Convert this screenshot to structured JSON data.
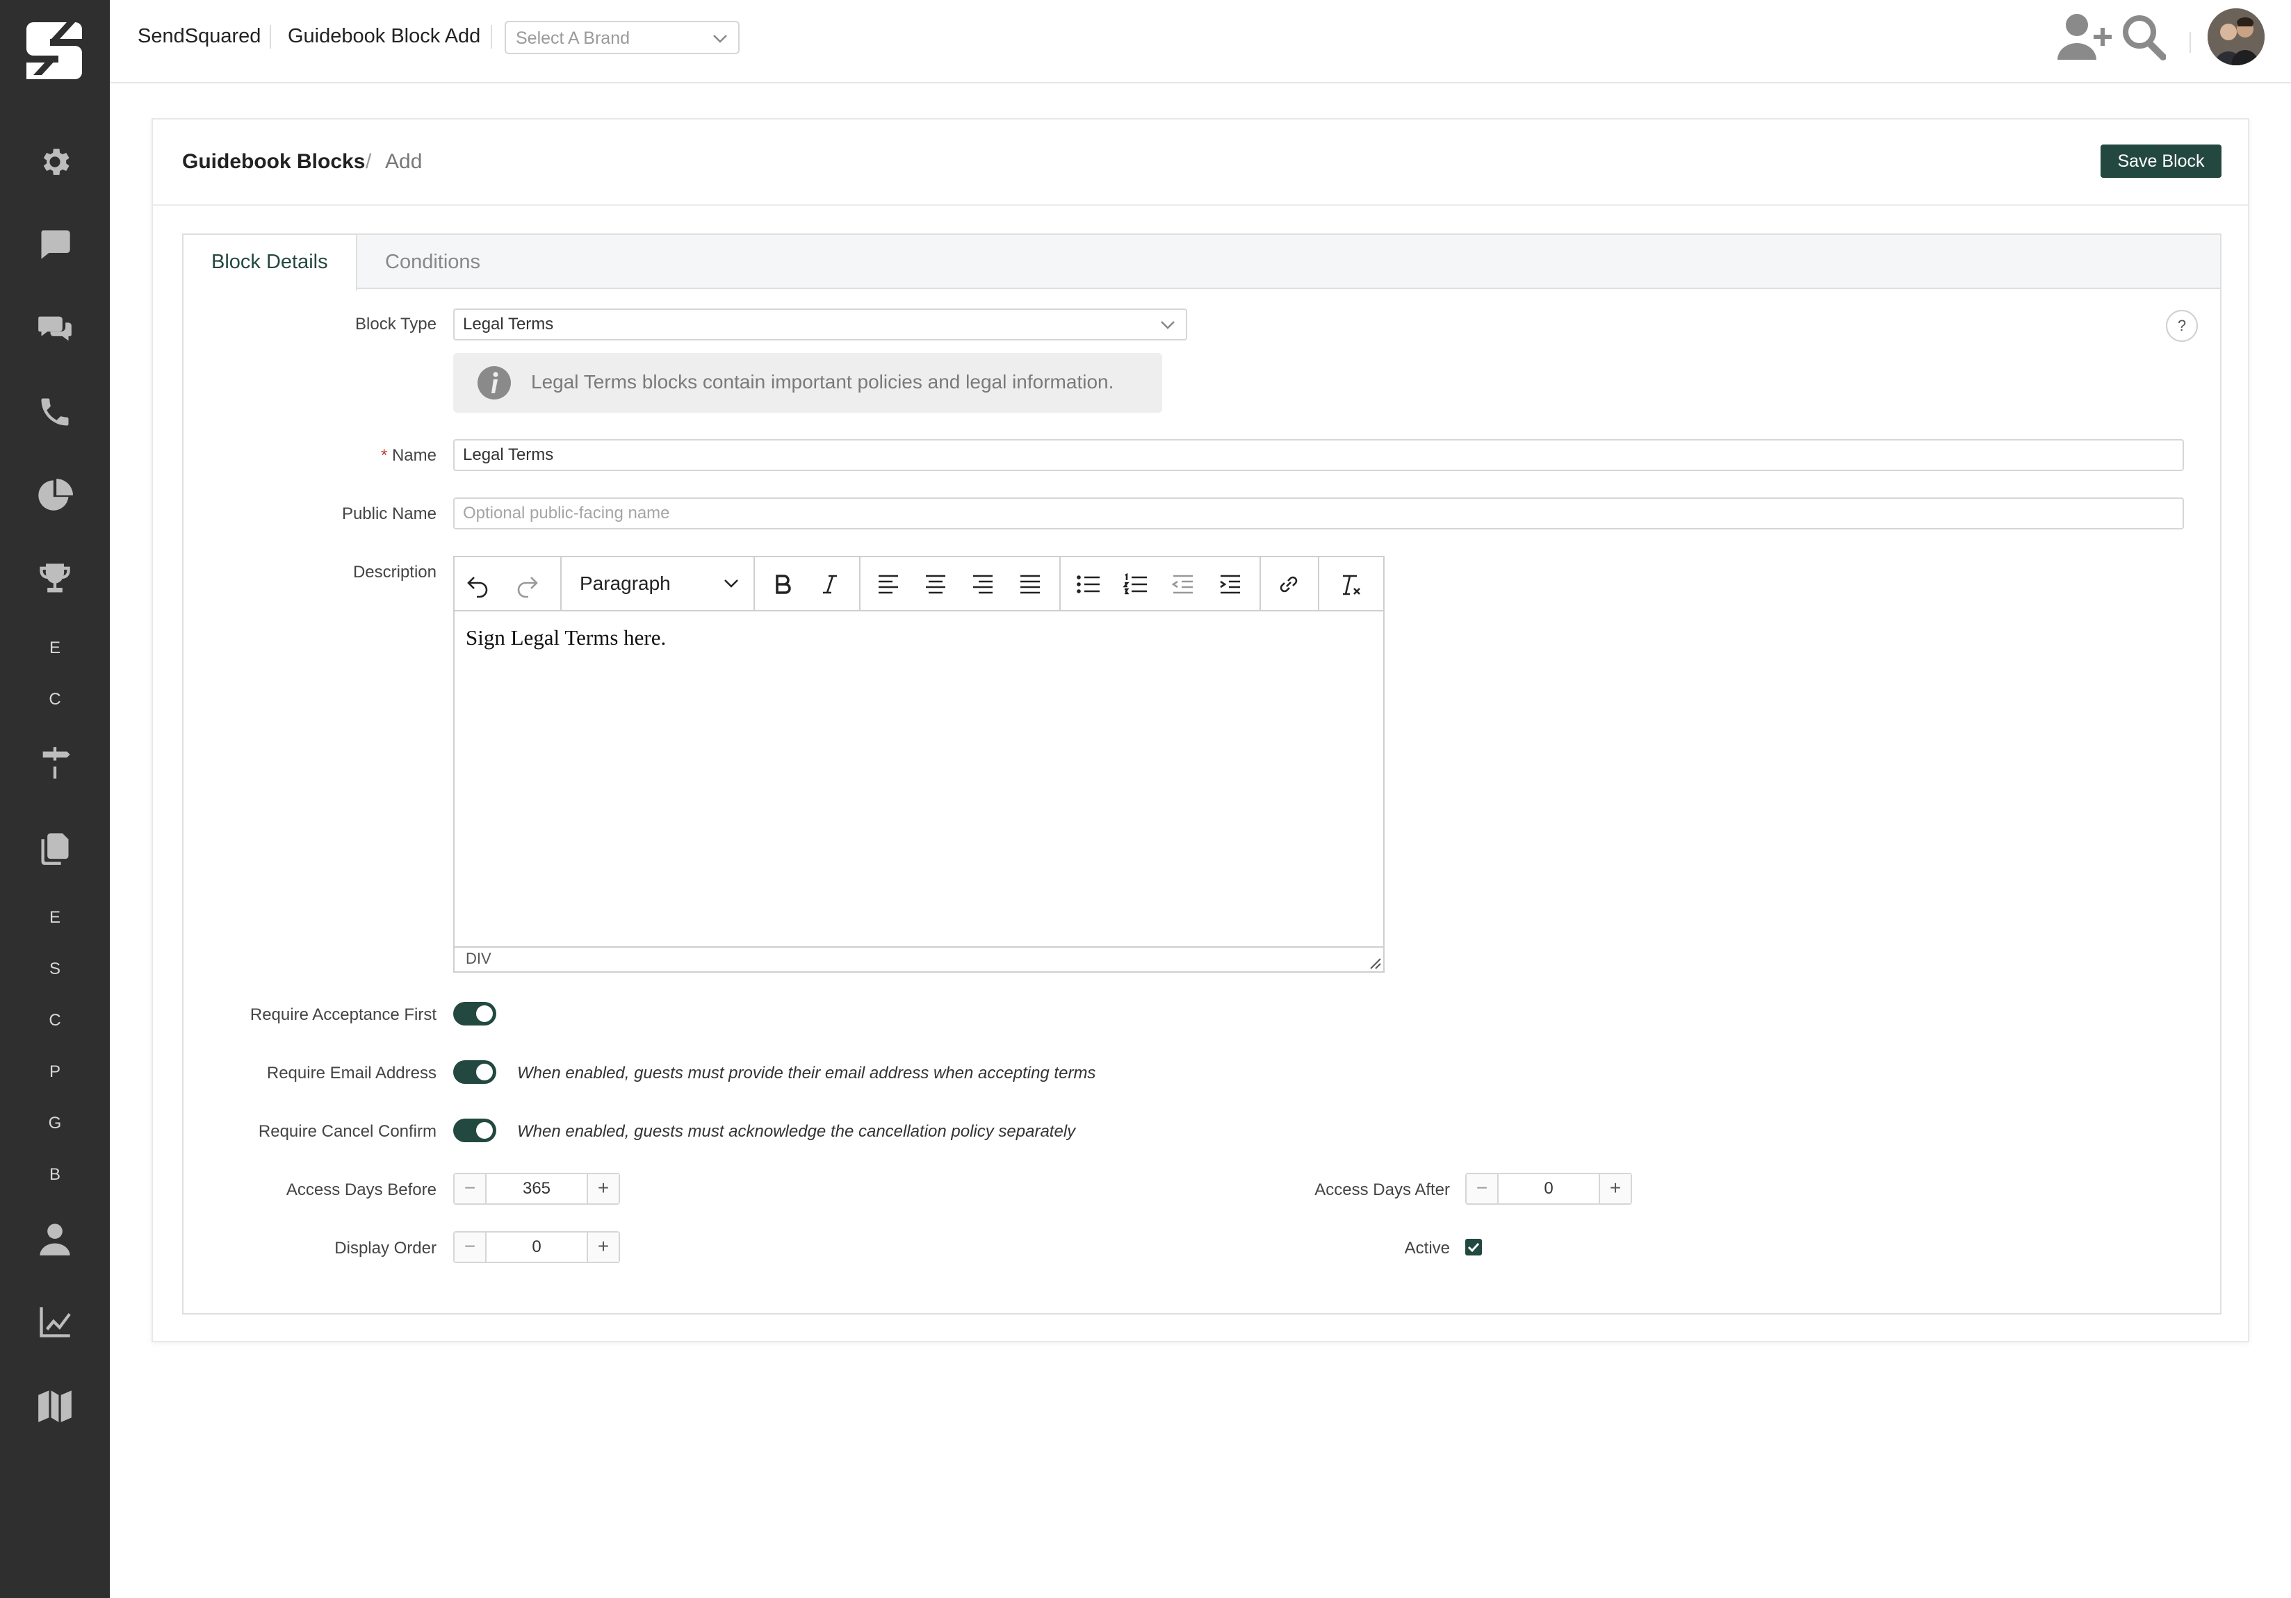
{
  "topbar": {
    "app_name": "SendSquared",
    "page_name": "Guidebook Block Add",
    "brand_placeholder": "Select A Brand"
  },
  "sidebar": {
    "letters": [
      "E",
      "C",
      "E",
      "S",
      "C",
      "P",
      "G",
      "B"
    ]
  },
  "card": {
    "breadcrumb_root": "Guidebook Blocks",
    "breadcrumb_sep": "/",
    "breadcrumb_current": "Add",
    "save_label": "Save Block"
  },
  "tabs": [
    {
      "label": "Block Details",
      "active": true
    },
    {
      "label": "Conditions",
      "active": false
    }
  ],
  "form": {
    "block_type_label": "Block Type",
    "block_type_value": "Legal Terms",
    "info_text": "Legal Terms blocks contain important policies and legal information.",
    "help_label": "?",
    "name_required_mark": "*",
    "name_label": "Name",
    "name_value": "Legal Terms",
    "public_name_label": "Public Name",
    "public_name_placeholder": "Optional public-facing name",
    "description_label": "Description",
    "paragraph_label": "Paragraph",
    "editor_content": "Sign Legal Terms here.",
    "editor_status": "DIV",
    "require_acceptance_label": "Require Acceptance First",
    "require_email_label": "Require Email Address",
    "require_email_hint": "When enabled, guests must provide their email address when accepting terms",
    "require_cancel_label": "Require Cancel Confirm",
    "require_cancel_hint": "When enabled, guests must acknowledge the cancellation policy separately",
    "access_before_label": "Access Days Before",
    "access_before_value": "365",
    "access_after_label": "Access Days After",
    "access_after_value": "0",
    "display_order_label": "Display Order",
    "display_order_value": "0",
    "active_label": "Active",
    "stepper_minus": "−",
    "stepper_plus": "+"
  },
  "colors": {
    "accent": "#23483f",
    "sidebar_bg": "#2f2f2f"
  }
}
